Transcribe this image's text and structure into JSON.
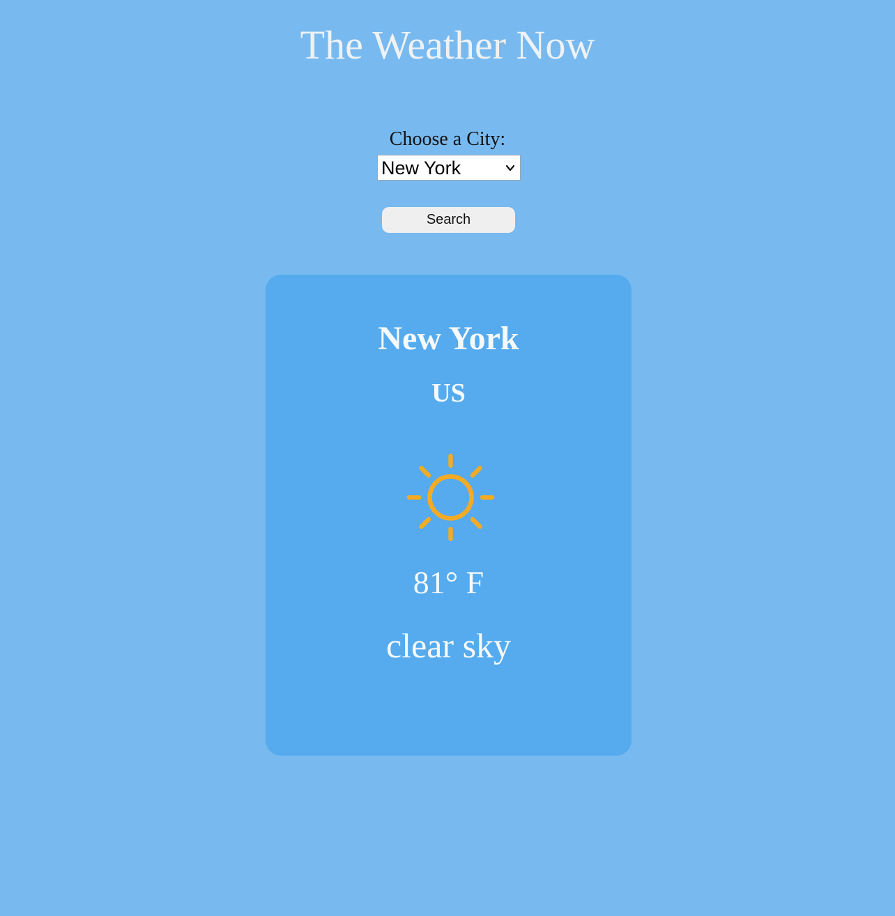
{
  "page": {
    "title": "The Weather Now",
    "background_color": "#78baef"
  },
  "form": {
    "label": "Choose a City:",
    "selected_city": "New York",
    "search_label": "Search"
  },
  "weather_card": {
    "city": "New York",
    "country": "US",
    "icon": "sun-icon",
    "icon_color": "#f3ab26",
    "temperature": "81° F",
    "description": "clear sky",
    "card_color": "#55abee"
  }
}
